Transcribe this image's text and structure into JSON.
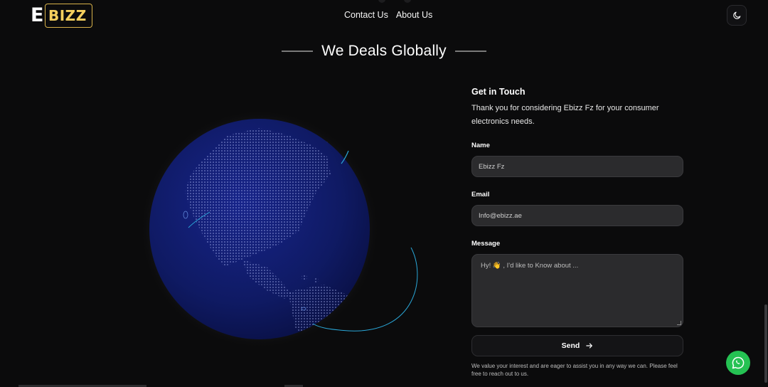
{
  "header": {
    "logo_letter": "E",
    "logo_word": "BIZZ",
    "nav": [
      "Contact Us",
      "About Us"
    ],
    "theme_icon": "moon-icon"
  },
  "section": {
    "title": "We Deals Globally"
  },
  "contact": {
    "heading": "Get in Touch",
    "intro": "Thank you for considering Ebizz Fz for your consumer electronics needs.",
    "name_label": "Name",
    "name_value": "Ebizz Fz",
    "email_label": "Email",
    "email_value": "Info@ebizz.ae",
    "message_label": "Message",
    "message_placeholder": "Hy! 👋 , I'd like to Know about ...",
    "send_label": "Send",
    "send_icon": "arrow-right-icon",
    "footnote": "We value your interest and are eager to assist you in any way we can. Please feel free to reach out to us."
  },
  "floating": {
    "whatsapp_icon": "whatsapp-icon"
  },
  "colors": {
    "background": "#0b0b0c",
    "brand_gold": "#f4cf5d",
    "globe": "#0f1a63",
    "arc": "#2aa7d8",
    "whatsapp": "#25c253",
    "input_bg": "#2b2b2d"
  }
}
